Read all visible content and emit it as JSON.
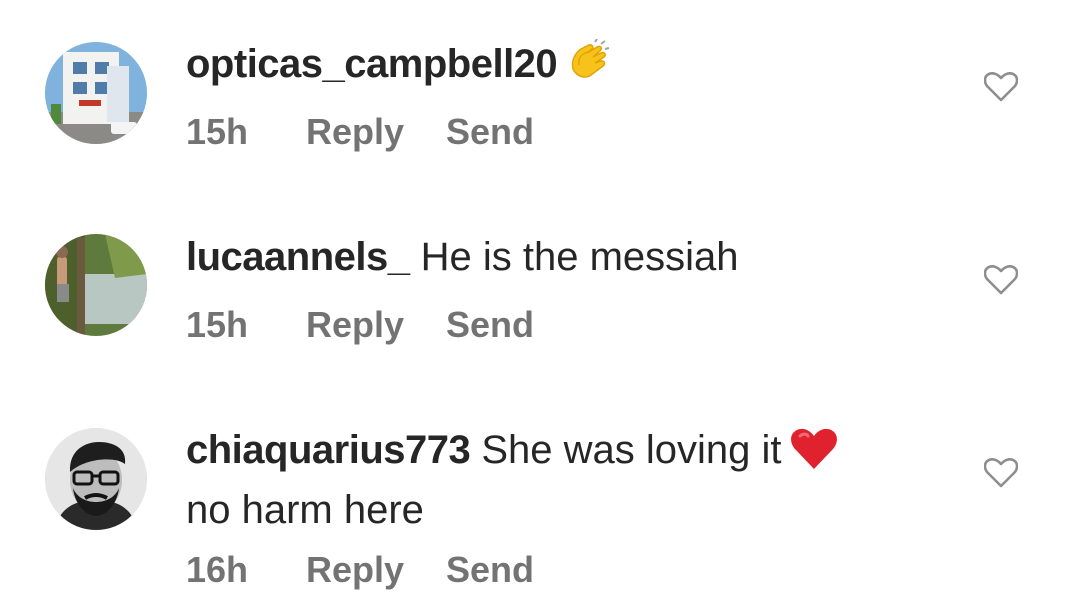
{
  "comments": [
    {
      "username": "opticas_campbell20",
      "text": "",
      "text_line2": "",
      "emoji": "clapping-hands-emoji",
      "time": "15h",
      "reply_label": "Reply",
      "send_label": "Send"
    },
    {
      "username": "lucaannels_",
      "text": "He is the messiah",
      "text_line2": "",
      "emoji": "",
      "time": "15h",
      "reply_label": "Reply",
      "send_label": "Send"
    },
    {
      "username": "chiaquarius773",
      "text": "She was loving it",
      "text_line2": "no harm here",
      "emoji": "red-heart-emoji",
      "time": "16h",
      "reply_label": "Reply",
      "send_label": "Send"
    }
  ],
  "colors": {
    "text": "#262626",
    "meta": "#737373",
    "heart_outline": "#8e8e8e",
    "heart_emoji": "#e0222f"
  }
}
